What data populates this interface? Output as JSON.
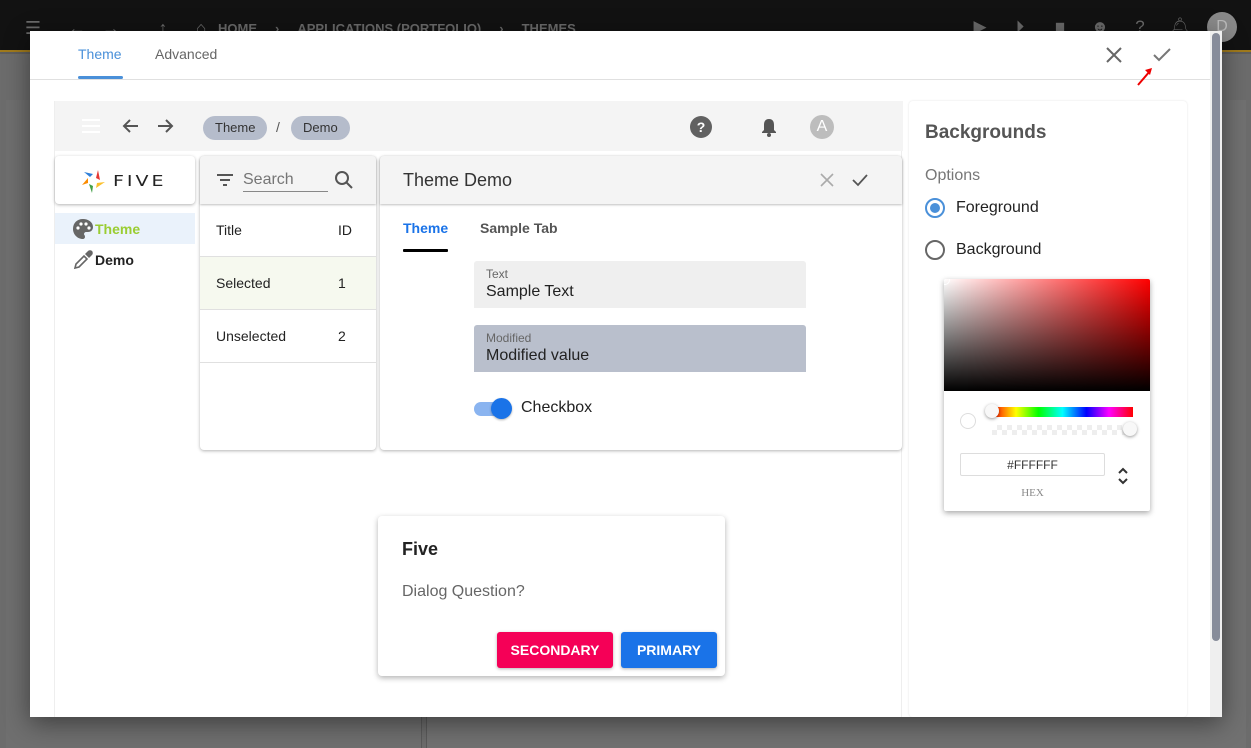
{
  "background_app": {
    "breadcrumbs": [
      "HOME",
      "APPLICATIONS (PORTFOLIO)",
      "THEMES"
    ],
    "avatar_initial": "D"
  },
  "modal": {
    "tabs": [
      {
        "label": "Theme",
        "active": true
      },
      {
        "label": "Advanced",
        "active": false
      }
    ]
  },
  "preview": {
    "breadcrumb": [
      "Theme",
      "Demo"
    ],
    "breadcrumb_separator": "/",
    "help_glyph": "?",
    "avatar_initial": "A",
    "logo_text": "FIVE",
    "menu": [
      {
        "label": "Theme",
        "icon": "palette-icon",
        "active": true
      },
      {
        "label": "Demo",
        "icon": "eyedropper-icon",
        "active": false
      }
    ],
    "list": {
      "search_placeholder": "Search",
      "columns": [
        "Title",
        "ID"
      ],
      "rows": [
        {
          "title": "Selected",
          "id": "1",
          "selected": true
        },
        {
          "title": "Unselected",
          "id": "2",
          "selected": false
        }
      ]
    },
    "form": {
      "title": "Theme Demo",
      "tabs": [
        {
          "label": "Theme",
          "active": true
        },
        {
          "label": "Sample Tab",
          "active": false
        }
      ],
      "fields": [
        {
          "label": "Text",
          "value": "Sample Text"
        },
        {
          "label": "Modified",
          "value": "Modified value"
        }
      ],
      "toggle": {
        "label": "Checkbox",
        "checked": true
      }
    },
    "dialog": {
      "title": "Five",
      "message": "Dialog Question?",
      "secondary_label": "SECONDARY",
      "primary_label": "PRIMARY"
    }
  },
  "right_panel": {
    "title": "Backgrounds",
    "options_label": "Options",
    "options": [
      {
        "label": "Foreground",
        "selected": true
      },
      {
        "label": "Background",
        "selected": false
      }
    ],
    "color_picker": {
      "hex_value": "#FFFFFF",
      "mode_label": "HEX",
      "hue": 0,
      "alpha": 1
    }
  },
  "colors": {
    "accent": "#4a90d9",
    "primary": "#1a73e8",
    "secondary": "#f50057",
    "menu_active_text": "#9acd32",
    "chip": "#b5bccb"
  }
}
